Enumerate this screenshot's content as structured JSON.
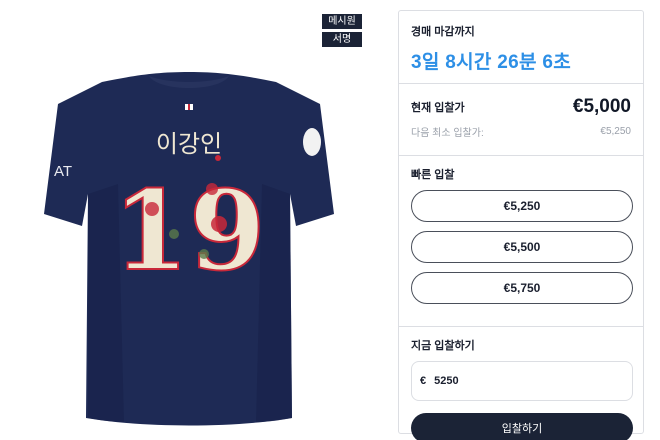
{
  "product": {
    "tags": [
      "메시원",
      "서명"
    ],
    "jersey": {
      "name_text": "이강인",
      "number": "19",
      "sleeve_text": "AT",
      "colors": {
        "body": "#1e2a55",
        "collar": "#27335e",
        "number_fill": "#efe7d2",
        "accent_red": "#c8283a"
      }
    }
  },
  "auction": {
    "countdown_label": "경매 마감까지",
    "countdown_value": "3일 8시간 26분 6초",
    "current_bid_label": "현재 입찰가",
    "current_bid_value": "€5,000",
    "next_min_label": "다음 최소 입찰가:",
    "next_min_value": "€5,250",
    "quick_bid_label": "빠른 입찰",
    "quick_bids": [
      "€5,250",
      "€5,500",
      "€5,750"
    ],
    "bid_now_label": "지금 입찰하기",
    "currency_symbol": "€",
    "bid_input_value": "5250",
    "submit_label": "입찰하기"
  },
  "colors": {
    "accent": "#2d8fe6",
    "dark": "#1b2336",
    "border": "#dcdee3"
  }
}
